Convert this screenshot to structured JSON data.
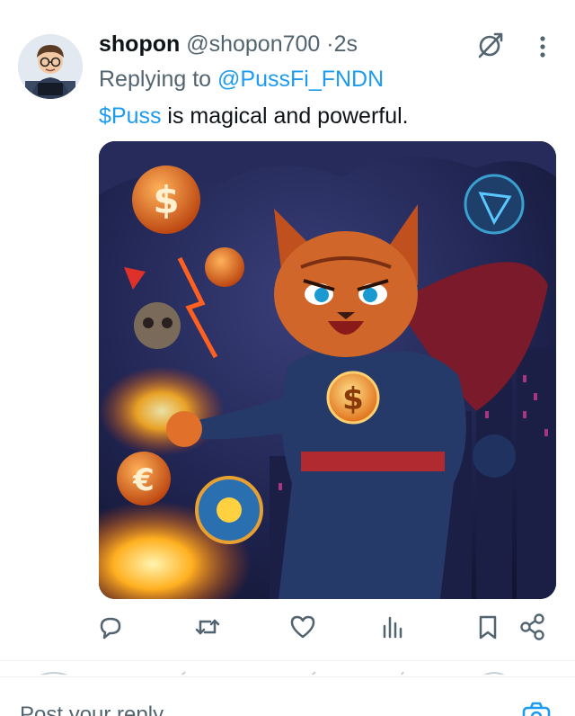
{
  "tweet": {
    "author_name": "shopon",
    "author_handle": "@shopon700",
    "separator": "·",
    "timestamp": "2s",
    "replying_prefix": "Replying to",
    "replying_to": "@PussFi_FNDN",
    "cashtag": "$Puss",
    "text_rest": " is magical and powerful."
  },
  "actions": {
    "reply": "reply-icon",
    "retweet": "retweet-icon",
    "like": "heart-icon",
    "views": "analytics-icon",
    "bookmark": "bookmark-icon",
    "share": "share-icon"
  },
  "reply_bar": {
    "placeholder": "Post your reply"
  },
  "colors": {
    "accent": "#1d9bf0",
    "secondary_text": "#536471",
    "primary_text": "#0f1419"
  }
}
